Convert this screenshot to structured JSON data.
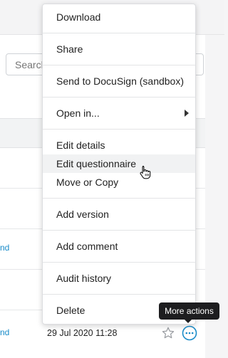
{
  "background": {
    "search": {
      "placeholder": "Search"
    },
    "rows": [
      {
        "link_fragment": ""
      },
      {
        "link_fragment": ""
      },
      {
        "link_fragment": "nd"
      },
      {
        "link_fragment": ""
      },
      {
        "link_fragment": "nd"
      }
    ],
    "last_row": {
      "date": "29 Jul 2020 11:28"
    }
  },
  "menu": {
    "items": [
      {
        "label": "Download"
      },
      {
        "label": "Share"
      },
      {
        "label": "Send to DocuSign (sandbox)"
      },
      {
        "label": "Open in...",
        "has_submenu": true
      },
      {
        "label": "Edit details"
      },
      {
        "label": "Edit questionnaire",
        "hovered": true
      },
      {
        "label": "Move or Copy"
      },
      {
        "label": "Add version"
      },
      {
        "label": "Add comment"
      },
      {
        "label": "Audit history"
      },
      {
        "label": "Delete"
      }
    ]
  },
  "tooltip": {
    "text": "More actions"
  },
  "icons": {
    "star": "star-outline-icon",
    "more": "more-actions-icon",
    "cursor": "hand-pointer-icon",
    "submenu": "chevron-right-icon"
  },
  "colors": {
    "accent": "#1a8cc9",
    "tooltip_bg": "#1d1d1f",
    "hover_bg": "#f1f2f3"
  }
}
